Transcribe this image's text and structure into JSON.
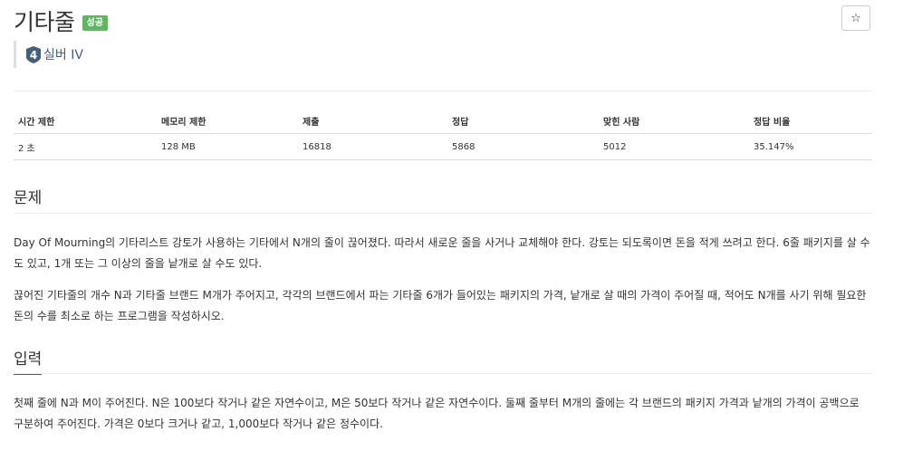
{
  "problem": {
    "title": "기타줄",
    "status_badge": "성공",
    "star_label": "☆",
    "tier_number": "4",
    "tier_label": "실버 IV"
  },
  "info_table": {
    "headers": [
      "시간 제한",
      "메모리 제한",
      "제출",
      "정답",
      "맞힌 사람",
      "정답 비율"
    ],
    "row": [
      "2 초",
      "128 MB",
      "16818",
      "5868",
      "5012",
      "35.147%"
    ]
  },
  "sections": {
    "problem_heading": "문제",
    "problem_p1": "Day Of Mourning의 기타리스트 강토가 사용하는 기타에서 N개의 줄이 끊어졌다. 따라서 새로운 줄을 사거나 교체해야 한다. 강토는 되도록이면 돈을 적게 쓰려고 한다. 6줄 패키지를 살 수도 있고, 1개 또는 그 이상의 줄을 낱개로 살 수도 있다.",
    "problem_p2": "끊어진 기타줄의 개수 N과 기타줄 브랜드 M개가 주어지고, 각각의 브랜드에서 파는 기타줄 6개가 들어있는 패키지의 가격, 낱개로 살 때의 가격이 주어질 때, 적어도 N개를 사기 위해 필요한 돈의 수를 최소로 하는 프로그램을 작성하시오.",
    "input_heading": "입력",
    "input_p1": "첫째 줄에 N과 M이 주어진다. N은 100보다 작거나 같은 자연수이고, M은 50보다 작거나 같은 자연수이다. 둘째 줄부터 M개의 줄에는 각 브랜드의 패키지 가격과 낱개의 가격이 공백으로 구분하여 주어진다. 가격은 0보다 크거나 같고, 1,000보다 작거나 같은 정수이다."
  },
  "colors": {
    "success_badge": "#5cb85c",
    "silver_tier": "#435f7a",
    "heading_underline": "#0076c0"
  }
}
